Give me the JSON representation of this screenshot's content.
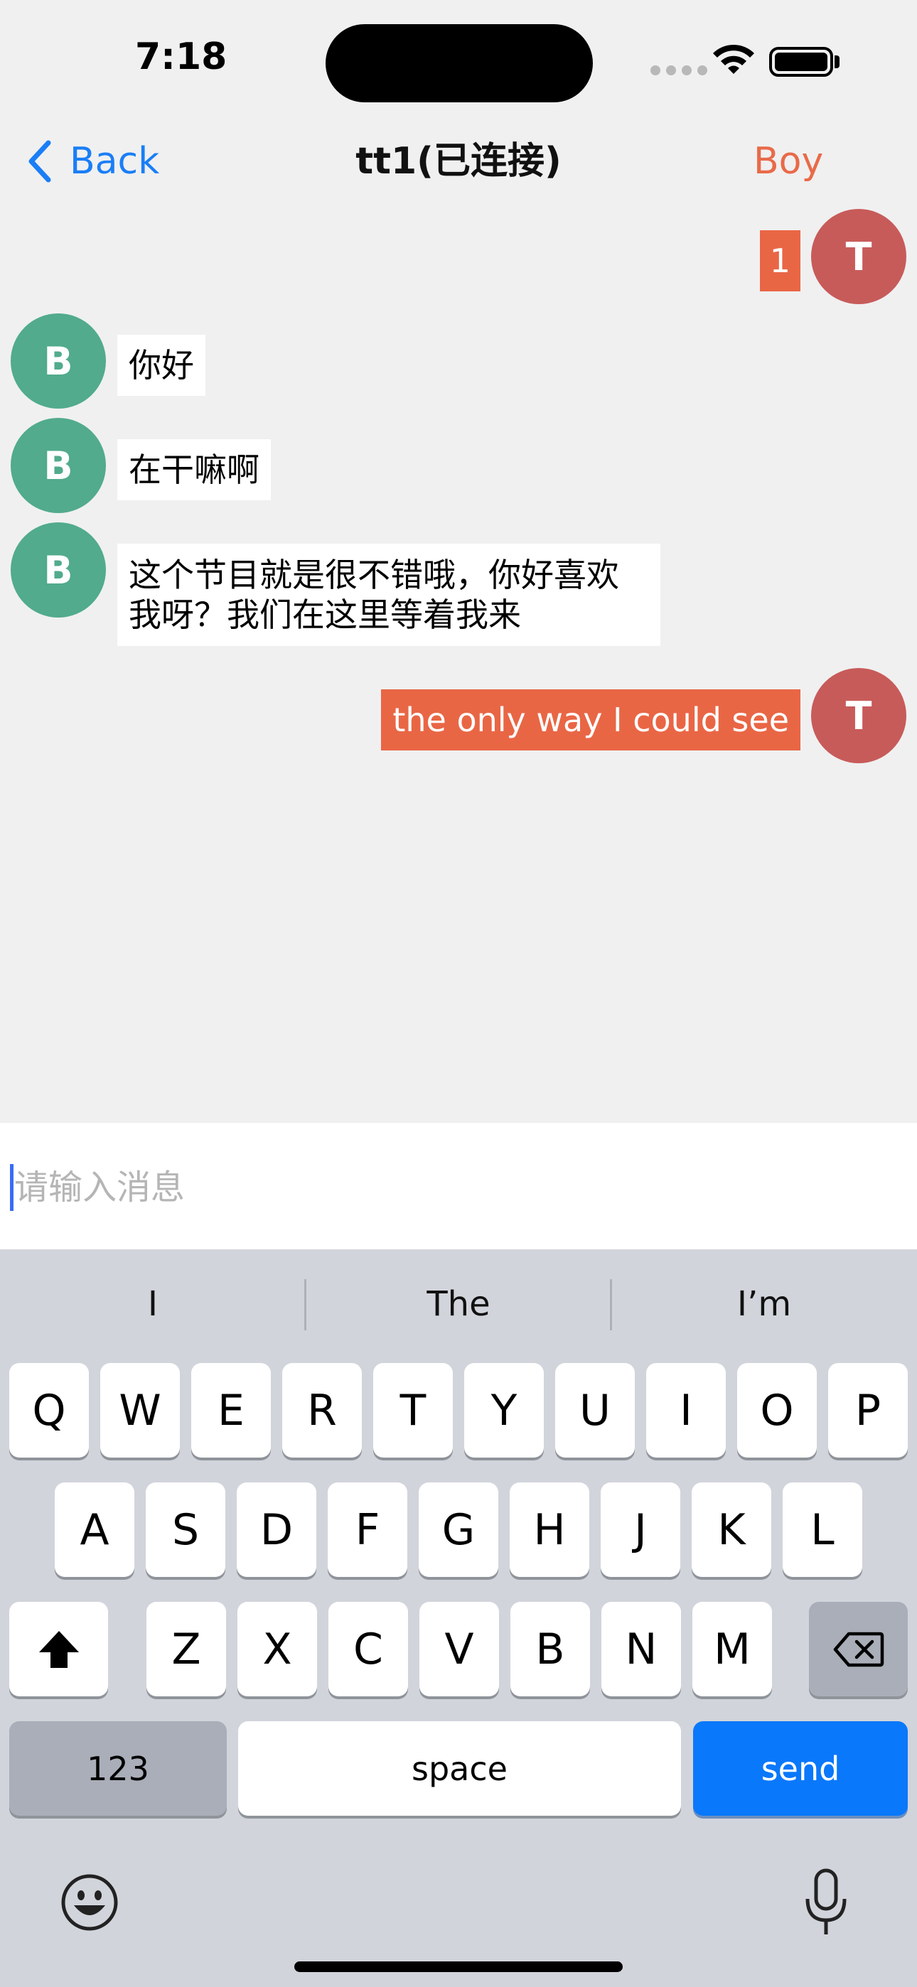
{
  "status_bar": {
    "time": "7:18"
  },
  "nav": {
    "back_label": "Back",
    "title": "tt1(已连接)",
    "right_label": "Boy"
  },
  "messages": [
    {
      "side": "out",
      "avatar": "T",
      "text": "1"
    },
    {
      "side": "in",
      "avatar": "B",
      "text": "你好"
    },
    {
      "side": "in",
      "avatar": "B",
      "text": "在干嘛啊"
    },
    {
      "side": "in",
      "avatar": "B",
      "lines": [
        "这个节目就是很不错哦，你好喜欢",
        "我呀？我们在这里等着我来"
      ]
    },
    {
      "side": "out",
      "avatar": "T",
      "text": "the only way I could see"
    }
  ],
  "input": {
    "placeholder": "请输入消息",
    "value": ""
  },
  "keyboard": {
    "suggestions": [
      "I",
      "The",
      "I’m"
    ],
    "row1": [
      "Q",
      "W",
      "E",
      "R",
      "T",
      "Y",
      "U",
      "I",
      "O",
      "P"
    ],
    "row2": [
      "A",
      "S",
      "D",
      "F",
      "G",
      "H",
      "J",
      "K",
      "L"
    ],
    "row3": [
      "Z",
      "X",
      "C",
      "V",
      "B",
      "N",
      "M"
    ],
    "numbers_label": "123",
    "space_label": "space",
    "send_label": "send",
    "icons": [
      "shift-icon",
      "delete-icon",
      "emoji-icon",
      "microphone-icon"
    ]
  },
  "colors": {
    "accent_blue": "#1a7ef6",
    "outgoing_bubble": "#e96645",
    "avatar_t": "#c75b5a",
    "avatar_b": "#51ab8c",
    "send_key": "#0a78fb"
  }
}
